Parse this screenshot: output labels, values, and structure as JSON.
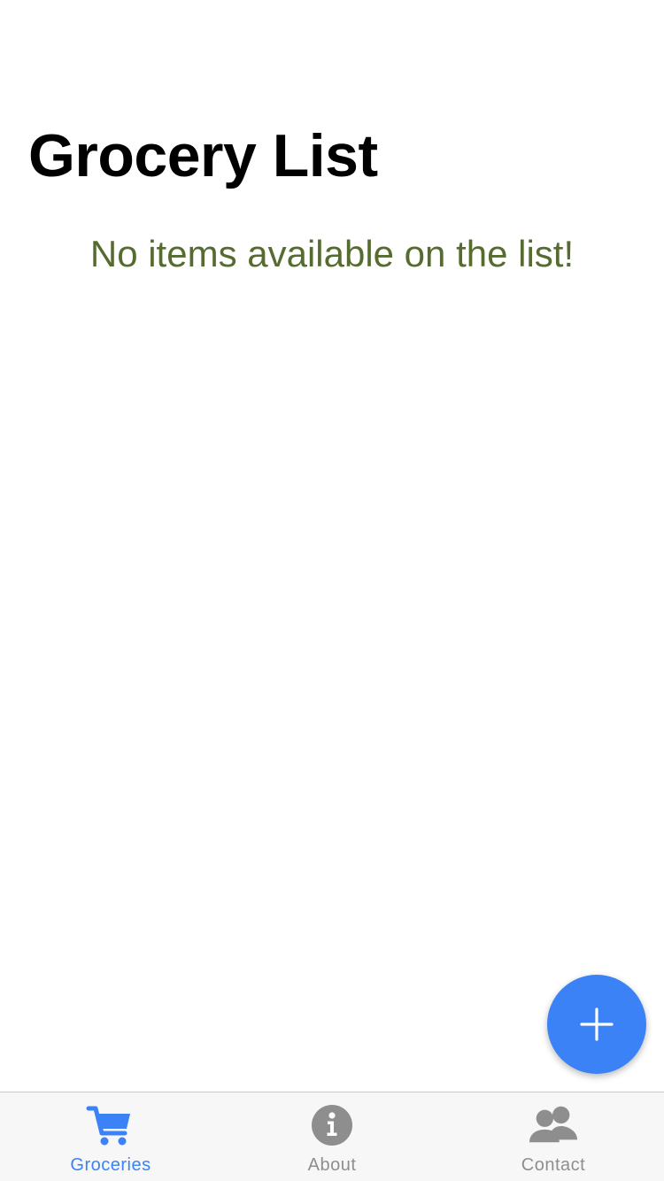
{
  "header": {
    "title": "Grocery List"
  },
  "main": {
    "empty_message": "No items available on the list!"
  },
  "fab": {
    "icon": "plus-icon"
  },
  "tabbar": {
    "tabs": [
      {
        "label": "Groceries",
        "icon": "cart-icon",
        "active": true
      },
      {
        "label": "About",
        "icon": "info-circle-icon",
        "active": false
      },
      {
        "label": "Contact",
        "icon": "users-icon",
        "active": false
      }
    ]
  },
  "colors": {
    "accent": "#3b82f6",
    "tab_active": "#3b82f6",
    "tab_inactive": "#8e8e8e",
    "empty_message": "#556b2f",
    "tabbar_background": "#f7f7f7"
  }
}
